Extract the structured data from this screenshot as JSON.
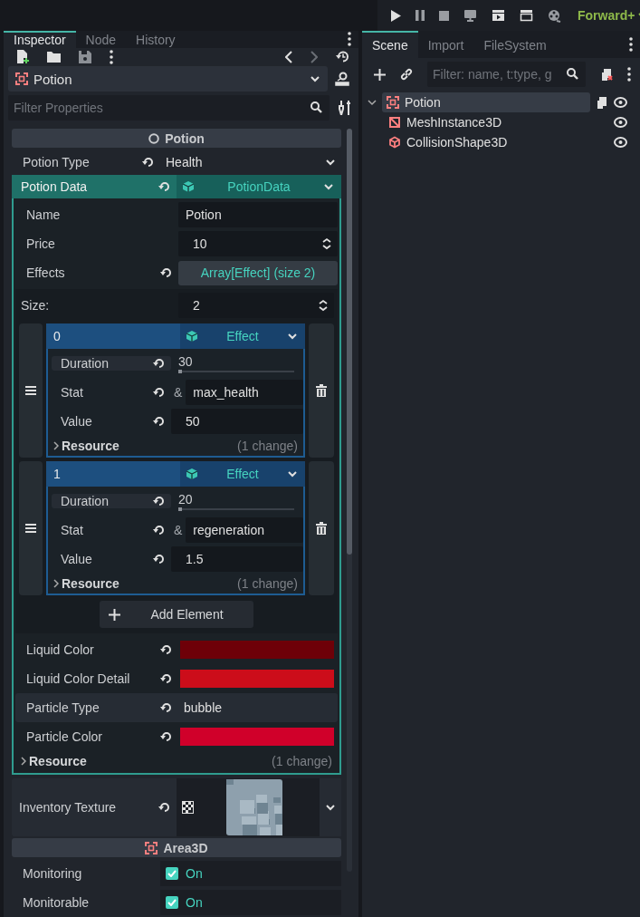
{
  "toolbar": {
    "renderer": "Forward+"
  },
  "inspector": {
    "tabs": [
      {
        "label": "Inspector",
        "selected": true
      },
      {
        "label": "Node",
        "selected": false
      },
      {
        "label": "History",
        "selected": false
      }
    ],
    "object": "Potion",
    "filter": {
      "placeholder": "Filter Properties"
    },
    "section": "Potion",
    "potion_type": {
      "label": "Potion Type",
      "value": "Health"
    },
    "potion_data": {
      "label": "Potion Data",
      "type": "PotionData",
      "properties": [
        {
          "kind": "text",
          "label": "Name",
          "value": "Potion"
        },
        {
          "kind": "spin",
          "label": "Price",
          "value": "10"
        },
        {
          "kind": "array",
          "label": "Effects",
          "value": "Array[Effect] (size 2)"
        }
      ],
      "array": {
        "size_label": "Size:",
        "size": "2",
        "elements": [
          {
            "index": "0",
            "type": "Effect",
            "duration": {
              "label": "Duration",
              "value": "30",
              "level": 0.02
            },
            "stat": {
              "label": "Stat",
              "prefix": "&",
              "value": "max_health"
            },
            "value": {
              "label": "Value",
              "value": "50"
            },
            "footer": {
              "label": "Resource",
              "changes": "(1 change)"
            }
          },
          {
            "index": "1",
            "type": "Effect",
            "duration": {
              "label": "Duration",
              "value": "20",
              "level": 0.02
            },
            "stat": {
              "label": "Stat",
              "prefix": "&",
              "value": "regeneration"
            },
            "value": {
              "label": "Value",
              "value": "1.5"
            },
            "footer": {
              "label": "Resource",
              "changes": "(1 change)"
            }
          }
        ],
        "add_button": "Add Element"
      },
      "more_properties": [
        {
          "kind": "color",
          "label": "Liquid Color",
          "color": "#6e0008"
        },
        {
          "kind": "color",
          "label": "Liquid Color Detail",
          "color": "#cc0d1a"
        },
        {
          "kind": "plain",
          "label": "Particle Type",
          "value": "bubble"
        },
        {
          "kind": "color",
          "label": "Particle Color",
          "color": "#d0002a"
        }
      ],
      "footer": {
        "label": "Resource",
        "changes": "(1 change)"
      }
    },
    "inventory_texture": {
      "label": "Inventory Texture",
      "kind": "picture"
    },
    "area_section": "Area3D",
    "checks": [
      {
        "label": "Monitoring",
        "value": "On",
        "checked": true
      },
      {
        "label": "Monitorable",
        "value": "On",
        "checked": true
      }
    ]
  },
  "scene": {
    "tabs": [
      {
        "label": "Scene",
        "selected": true
      },
      {
        "label": "Import",
        "selected": false
      },
      {
        "label": "FileSystem",
        "selected": false
      }
    ],
    "filter": {
      "placeholder": "Filter: name, t:type, g"
    },
    "tree": [
      {
        "name": "Potion",
        "kind": "area",
        "selected": true,
        "expanded": true,
        "children": [
          {
            "name": "MeshInstance3D",
            "kind": "mesh",
            "selected": false
          },
          {
            "name": "CollisionShape3D",
            "kind": "collision",
            "selected": false
          }
        ]
      }
    ]
  }
}
